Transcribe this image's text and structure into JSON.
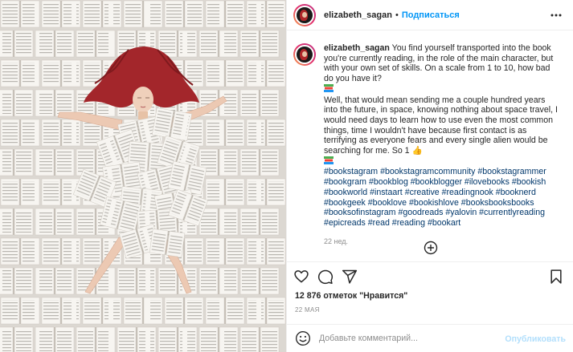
{
  "header": {
    "username": "elizabeth_sagan",
    "separator": "•",
    "follow_label": "Подписаться",
    "more_icon": "more-horizontal-icon"
  },
  "photo": {
    "alt_subject": "woman with red hair lying among open books"
  },
  "caption": {
    "username": "elizabeth_sagan",
    "text_1": "You find yourself transported into the book you're currently reading, in the role of the main character, but with your own set of skills. On a scale from 1 to 10, how bad do you have it?",
    "text_2": "Well, that would mean sending me a couple hundred years into the future, in space, knowing nothing about space travel, I would need days to learn how to use even the most common things, time I wouldn't have because first contact is as terrifying as everyone fears and every single alien would be searching for me. So 1",
    "thumbs_emoji": "👍",
    "hashtags": "#bookstagram #bookstagramcommunity #bookstagrammer #bookgram #bookblog #bookblogger #ilovebooks #bookish #bookworld #instaart #creative #readingnook #booknerd #bookgeek #booklove #bookishlove #booksbooksbooks #booksofinstagram #goodreads #yalovin #currentlyreading #epicreads #read #reading #bookart",
    "age": "22 нед."
  },
  "load_more_icon": "plus-circle-icon",
  "actions": {
    "like_icon": "heart-icon",
    "comment_icon": "comment-icon",
    "share_icon": "paper-plane-icon",
    "save_icon": "bookmark-icon"
  },
  "likes_text": "12 876 отметок \"Нравится\"",
  "date_text": "22 МАЯ",
  "add_comment": {
    "emoji_icon": "smiley-icon",
    "placeholder": "Добавьте комментарий...",
    "publish_label": "Опубликовать"
  },
  "colors": {
    "link_blue": "#0095f6",
    "hashtag_blue": "#00376b",
    "publish_disabled": "#b2dffc",
    "muted_text": "#8e8e8e",
    "hair_red": "#b0262a"
  }
}
